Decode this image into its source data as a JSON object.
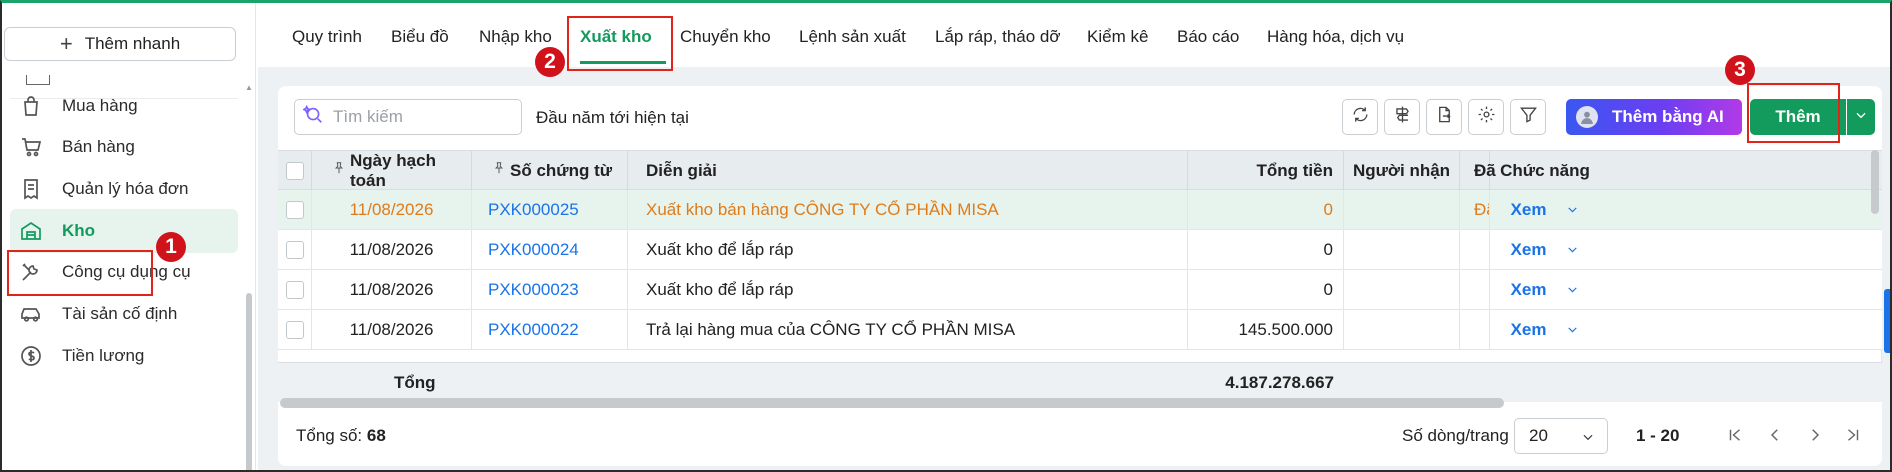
{
  "sidebar": {
    "quick_add_label": "Thêm nhanh",
    "items": [
      {
        "label": "Mua hàng",
        "icon": "shopping-bag-icon"
      },
      {
        "label": "Bán hàng",
        "icon": "cart-icon"
      },
      {
        "label": "Quản lý hóa đơn",
        "icon": "receipt-icon"
      },
      {
        "label": "Kho",
        "icon": "warehouse-icon",
        "active": true
      },
      {
        "label": "Công cụ dụng cụ",
        "icon": "tools-icon"
      },
      {
        "label": "Tài sản cố định",
        "icon": "car-icon"
      },
      {
        "label": "Tiền lương",
        "icon": "dollar-circle-icon"
      }
    ]
  },
  "topnav": {
    "tabs": [
      {
        "label": "Quy trình"
      },
      {
        "label": "Biểu đồ"
      },
      {
        "label": "Nhập kho"
      },
      {
        "label": "Xuất kho",
        "active": true
      },
      {
        "label": "Chuyển kho"
      },
      {
        "label": "Lệnh sản xuất"
      },
      {
        "label": "Lắp ráp, tháo dỡ"
      },
      {
        "label": "Kiểm kê"
      },
      {
        "label": "Báo cáo"
      },
      {
        "label": "Hàng hóa, dịch vụ"
      }
    ]
  },
  "toolbar": {
    "search_placeholder": "Tìm kiếm",
    "period": "Đầu năm tới hiện tại",
    "ai_button": "Thêm bằng AI",
    "add_button": "Thêm"
  },
  "table": {
    "columns": [
      "Ngày hạch toán",
      "Số chứng từ",
      "Diễn giải",
      "Tổng tiền",
      "Người nhận",
      "Đã",
      "Chức năng"
    ],
    "rows": [
      {
        "date": "11/08/2026",
        "doc": "PXK000025",
        "desc": "Xuất kho bán hàng CÔNG TY CỔ PHẦN MISA",
        "amount": "0",
        "receiver": "",
        "status": "Đã",
        "action": "Xem"
      },
      {
        "date": "11/08/2026",
        "doc": "PXK000024",
        "desc": "Xuất kho để lắp ráp",
        "amount": "0",
        "receiver": "",
        "status": "",
        "action": "Xem"
      },
      {
        "date": "11/08/2026",
        "doc": "PXK000023",
        "desc": "Xuất kho để lắp ráp",
        "amount": "0",
        "receiver": "",
        "status": "",
        "action": "Xem"
      },
      {
        "date": "11/08/2026",
        "doc": "PXK000022",
        "desc": "Trả lại hàng mua của CÔNG TY CỔ PHẦN MISA",
        "amount": "145.500.000",
        "receiver": "",
        "status": "",
        "action": "Xem"
      }
    ],
    "footer_label": "Tổng",
    "footer_total": "4.187.278.667"
  },
  "pagination": {
    "total_label": "Tổng số:",
    "total_value": "68",
    "per_page_label": "Số dòng/trang",
    "per_page_value": "20",
    "range": "1 - 20"
  },
  "annotations": [
    "1",
    "2",
    "3"
  ],
  "colors": {
    "accent": "#139a5d",
    "link": "#1a73e8",
    "highlight_text": "#e07b1a",
    "annotation": "#e2231a"
  }
}
